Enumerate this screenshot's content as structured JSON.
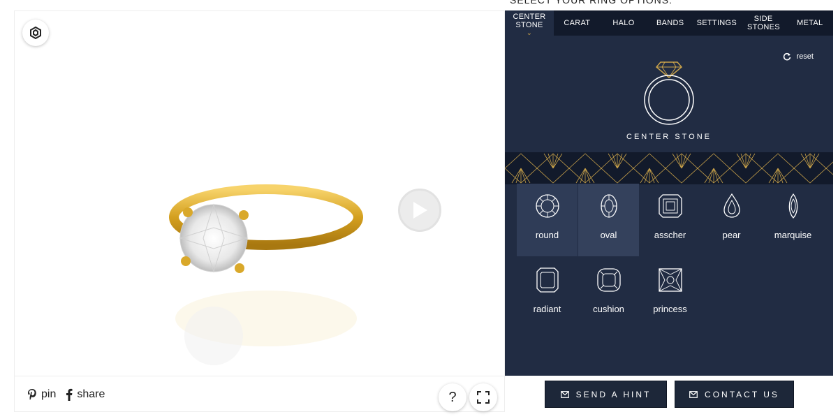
{
  "page": {
    "heading": "SELECT YOUR RING OPTIONS:"
  },
  "viewer": {
    "social": {
      "pin_label": "pin",
      "share_label": "share"
    },
    "help_icon": "?"
  },
  "panel": {
    "tabs": [
      {
        "label": "CENTER STONE",
        "active": true
      },
      {
        "label": "CARAT"
      },
      {
        "label": "HALO"
      },
      {
        "label": "BANDS"
      },
      {
        "label": "SETTINGS"
      },
      {
        "label": "SIDE STONES"
      },
      {
        "label": "METAL"
      }
    ],
    "reset_label": "reset",
    "section_title": "CENTER STONE",
    "shapes": [
      {
        "label": "round",
        "icon": "round-diamond-icon",
        "selected": true
      },
      {
        "label": "oval",
        "icon": "oval-diamond-icon"
      },
      {
        "label": "asscher",
        "icon": "asscher-diamond-icon"
      },
      {
        "label": "pear",
        "icon": "pear-diamond-icon"
      },
      {
        "label": "marquise",
        "icon": "marquise-diamond-icon"
      },
      {
        "label": "radiant",
        "icon": "radiant-diamond-icon"
      },
      {
        "label": "cushion",
        "icon": "cushion-diamond-icon"
      },
      {
        "label": "princess",
        "icon": "princess-diamond-icon"
      }
    ]
  },
  "buttons": {
    "send_hint": "SEND A HINT",
    "contact_us": "CONTACT US"
  },
  "colors": {
    "panel_bg": "#212c43",
    "tab_bg": "#121a2b",
    "gold": "#c9a24a"
  }
}
